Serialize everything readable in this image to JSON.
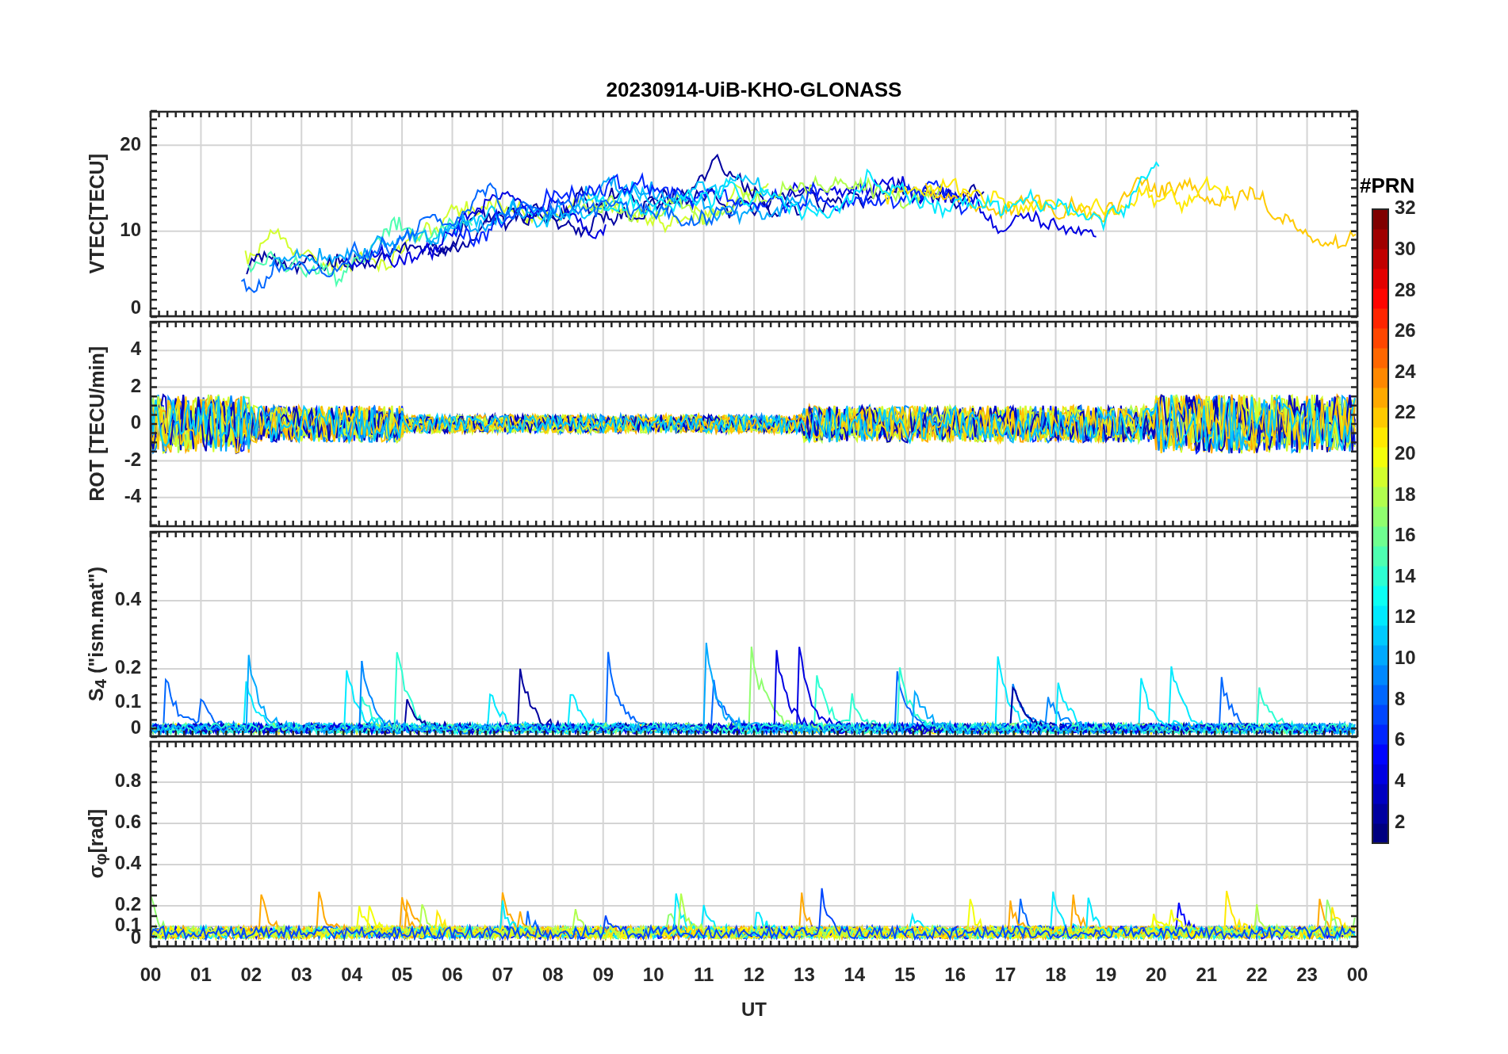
{
  "figure": {
    "title": "20230914-UiB-KHO-GLONASS",
    "panels": [
      {
        "kind": "vtec",
        "ylabel": "VTEC[TECU]",
        "yticks": [
          "20",
          "10",
          "0"
        ]
      },
      {
        "kind": "rot",
        "ylabel": "ROT [TECU/min]",
        "yticks": [
          "4",
          "2",
          "0",
          "-2",
          "-4"
        ]
      },
      {
        "kind": "s4",
        "ylabel": "S$_{4}$ (\"ism.mat\")",
        "yticks": [
          "0.4",
          "0.2",
          "0.1",
          "0"
        ]
      },
      {
        "kind": "sigma",
        "ylabel": "σ$_{φ}$[rad]",
        "yticks": [
          "0.8",
          "0.6",
          "0.4",
          "0.2",
          "0.1",
          "0"
        ]
      }
    ],
    "xticks": [
      "00",
      "01",
      "02",
      "03",
      "04",
      "05",
      "06",
      "07",
      "08",
      "09",
      "10",
      "11",
      "12",
      "13",
      "14",
      "15",
      "16",
      "17",
      "18",
      "19",
      "20",
      "21",
      "22",
      "23",
      "00"
    ],
    "xlabel": "UT",
    "colorbar": {
      "title": "#PRN",
      "ticks": [
        "32",
        "30",
        "28",
        "26",
        "24",
        "22",
        "20",
        "18",
        "16",
        "14",
        "12",
        "10",
        "8",
        "6",
        "4",
        "2"
      ]
    }
  }
}
